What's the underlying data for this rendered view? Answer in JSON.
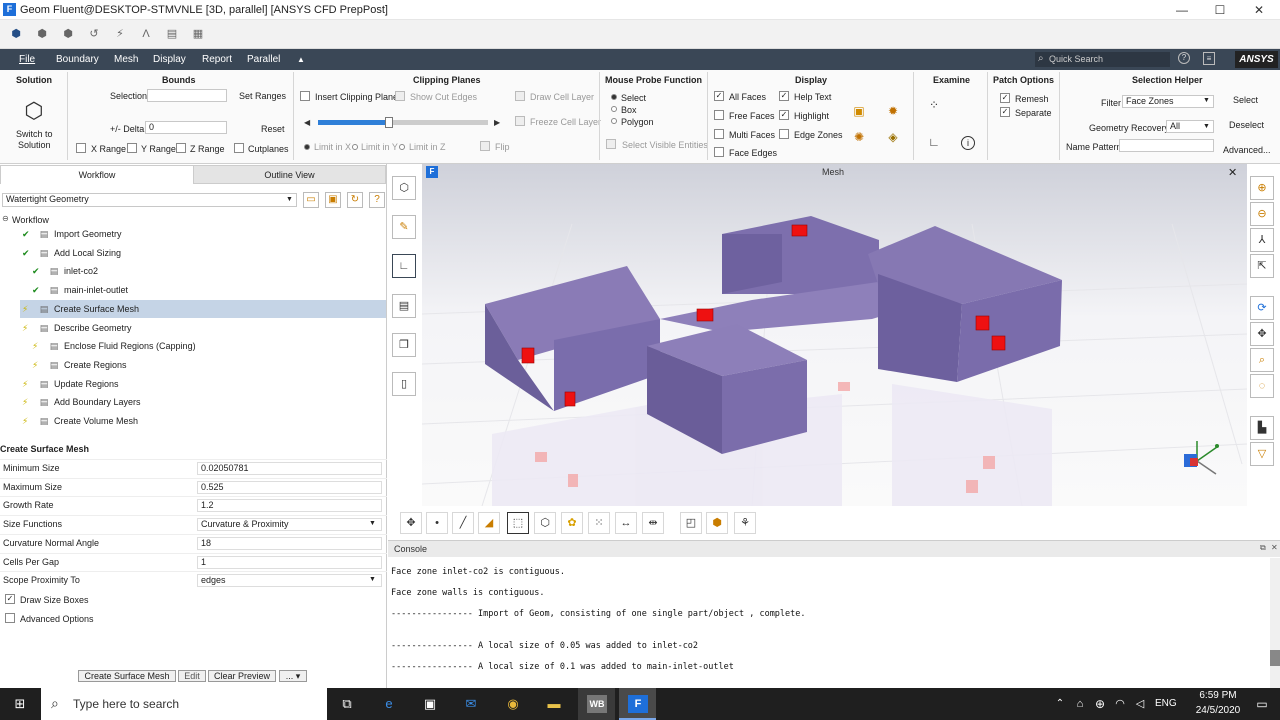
{
  "window": {
    "title": "Geom Fluent@DESKTOP-STMVNLE  [3D, parallel] [ANSYS CFD PrepPost]",
    "app_icon": "F",
    "minimize": "—",
    "maximize": "☐",
    "close": "✕"
  },
  "menu": {
    "items": [
      "File",
      "Boundary",
      "Mesh",
      "Display",
      "Report",
      "Parallel"
    ],
    "collapse_glyph": "▲",
    "quick_search_placeholder": "Quick Search",
    "logo": "ANSYS"
  },
  "ribbon": {
    "solution": {
      "title": "Solution",
      "switch_label": "Switch to",
      "switch_label2": "Solution"
    },
    "bounds": {
      "title": "Bounds",
      "selection_label": "Selection",
      "set_ranges": "Set Ranges",
      "delta_label": "+/- Delta",
      "delta_value": "0",
      "reset": "Reset",
      "x_range": "X Range",
      "y_range": "Y Range",
      "z_range": "Z Range",
      "cutplanes": "Cutplanes"
    },
    "clipping": {
      "title": "Clipping Planes",
      "insert": "Insert Clipping Plane",
      "show_cut_edges": "Show Cut Edges",
      "draw_cell_layer": "Draw Cell Layer",
      "freeze_cell_layer": "Freeze Cell Layer",
      "limit_x": "Limit in X",
      "limit_y": "Limit in Y",
      "limit_z": "Limit in Z",
      "flip": "Flip",
      "slider_fraction": 0.42
    },
    "probe": {
      "title": "Mouse Probe Function",
      "select": "Select",
      "box": "Box",
      "polygon": "Polygon",
      "select_visible": "Select Visible Entities"
    },
    "display": {
      "title": "Display",
      "all_faces": "All Faces",
      "free_faces": "Free Faces",
      "multi_faces": "Multi Faces",
      "face_edges": "Face Edges",
      "help_text": "Help Text",
      "highlight": "Highlight",
      "edge_zones": "Edge Zones"
    },
    "examine": {
      "title": "Examine"
    },
    "patch": {
      "title": "Patch Options",
      "remesh": "Remesh",
      "separate": "Separate"
    },
    "selection_helper": {
      "title": "Selection Helper",
      "filter_label": "Filter",
      "filter_value": "Face Zones",
      "select": "Select",
      "geometry_recovery_label": "Geometry Recovery",
      "geometry_recovery_value": "All",
      "deselect": "Deselect",
      "name_pattern_label": "Name Pattern",
      "advanced": "Advanced..."
    }
  },
  "left_panel": {
    "tabs": [
      "Workflow",
      "Outline View"
    ],
    "workflow_select": "Watertight Geometry",
    "tree": {
      "root": "Workflow",
      "items": [
        {
          "label": "Import Geometry",
          "status": "done",
          "level": 1
        },
        {
          "label": "Add Local Sizing",
          "status": "done",
          "level": 1
        },
        {
          "label": "inlet-co2",
          "status": "done",
          "level": 2
        },
        {
          "label": "main-inlet-outlet",
          "status": "done",
          "level": 2
        },
        {
          "label": "Create Surface Mesh",
          "status": "pending",
          "level": 1
        },
        {
          "label": "Describe Geometry",
          "status": "pending",
          "level": 1
        },
        {
          "label": "Enclose Fluid Regions (Capping)",
          "status": "pending",
          "level": 2
        },
        {
          "label": "Create Regions",
          "status": "pending",
          "level": 2
        },
        {
          "label": "Update Regions",
          "status": "pending",
          "level": 1
        },
        {
          "label": "Add Boundary Layers",
          "status": "pending",
          "level": 1
        },
        {
          "label": "Create Volume Mesh",
          "status": "pending",
          "level": 1
        }
      ]
    },
    "props": {
      "title": "Create Surface Mesh",
      "rows": [
        {
          "label": "Minimum Size",
          "value": "0.02050781"
        },
        {
          "label": "Maximum Size",
          "value": "0.525"
        },
        {
          "label": "Growth Rate",
          "value": "1.2"
        },
        {
          "label": "Size Functions",
          "value": "Curvature & Proximity"
        },
        {
          "label": "Curvature Normal Angle",
          "value": "18"
        },
        {
          "label": "Cells Per Gap",
          "value": "1"
        },
        {
          "label": "Scope Proximity To",
          "value": "edges"
        }
      ],
      "draw_size_boxes": "Draw Size Boxes",
      "advanced_options": "Advanced Options"
    },
    "buttons": {
      "create": "Create Surface Mesh",
      "edit": "Edit",
      "clear": "Clear Preview",
      "more": "...  ▾"
    }
  },
  "viewport": {
    "title": "Mesh",
    "badge": "F",
    "close": "✕"
  },
  "console": {
    "title": "Console",
    "lines": [
      "Face zone inlet-co2 is contiguous.",
      "Face zone walls is contiguous.",
      "---------------- Import of Geom, consisting of one single part/object , complete.",
      "---------------- A local size of 0.05 was added to inlet-co2",
      "---------------- A local size of 0.1 was added to main-inlet-outlet"
    ]
  },
  "taskbar": {
    "search_placeholder": "Type here to search",
    "lang": "ENG",
    "time": "6:59 PM",
    "date": "24/5/2020"
  },
  "colors": {
    "menubar": "#3a4756",
    "mesh_body": "#7c6ea9",
    "size_box": "#ee1111",
    "taskbar": "#1f1f1f"
  }
}
